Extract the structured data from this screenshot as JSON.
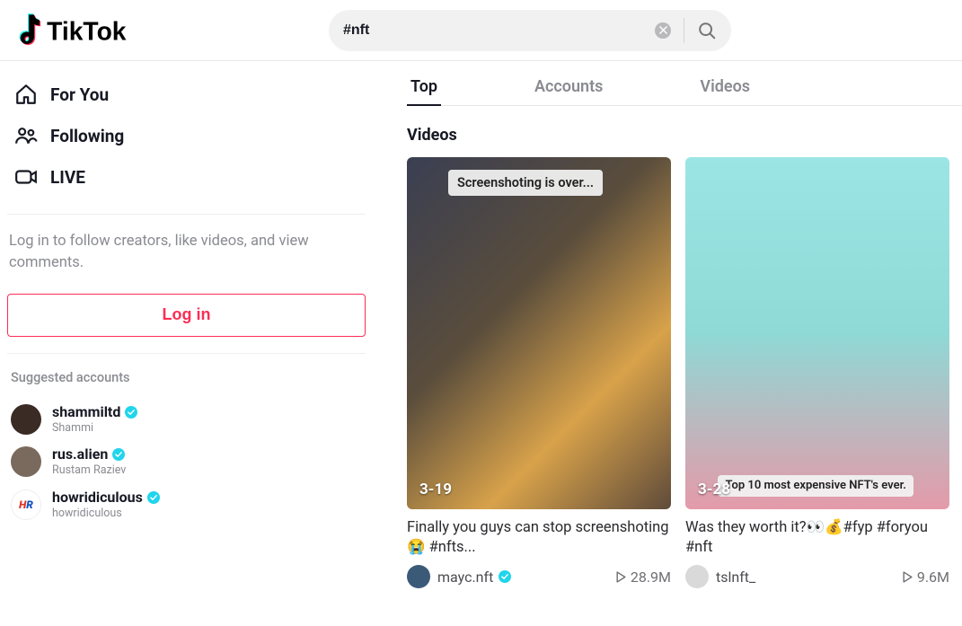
{
  "logoText": "TikTok",
  "search": {
    "value": "#nft"
  },
  "nav": [
    {
      "label": "For You"
    },
    {
      "label": "Following"
    },
    {
      "label": "LIVE"
    }
  ],
  "loginPrompt": "Log in to follow creators, like videos, and view comments.",
  "loginButton": "Log in",
  "suggestedTitle": "Suggested accounts",
  "suggested": [
    {
      "user": "shammiltd",
      "name": "Shammi",
      "verified": true,
      "avBg": "#3a2b25"
    },
    {
      "user": "rus.alien",
      "name": "Rustam Raziev",
      "verified": true,
      "avBg": "#7a6a5e"
    },
    {
      "user": "howridiculous",
      "name": "howridiculous",
      "verified": true,
      "avBg": "#ffffff"
    }
  ],
  "tabs": [
    {
      "label": "Top",
      "active": true
    },
    {
      "label": "Accounts",
      "active": false
    },
    {
      "label": "Videos",
      "active": false
    }
  ],
  "sectionTitle": "Videos",
  "videos": [
    {
      "chipTop": "Screenshoting is over...",
      "date": "3-19",
      "caption": "Finally you guys can stop screenshoting 😭 #nfts...",
      "user": "mayc.nft",
      "verified": true,
      "plays": "28.9M",
      "avBg": "#3b5a78"
    },
    {
      "chipBottom": "Top 10 most expensive NFT's ever.",
      "date": "3-28",
      "caption": "Was they worth it?👀💰#fyp #foryou #nft",
      "user": "tslnft_",
      "verified": false,
      "plays": "9.6M",
      "avBg": "#d9d9d9"
    }
  ]
}
